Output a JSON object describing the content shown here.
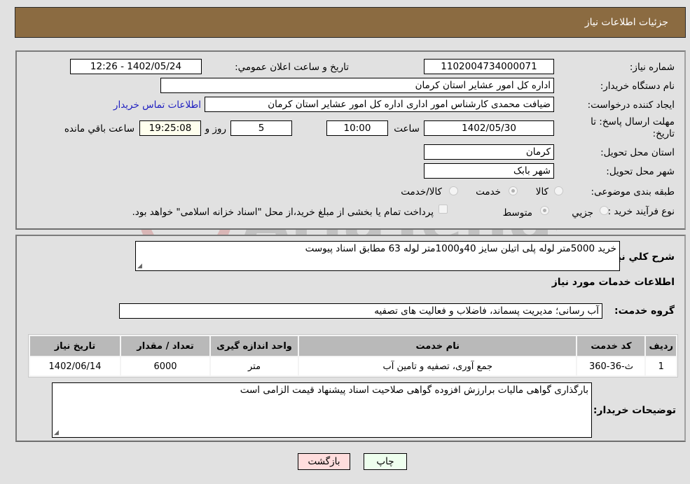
{
  "header": {
    "title": "جزئیات اطلاعات نیاز"
  },
  "form": {
    "need_number": {
      "label": "شماره نیاز:",
      "value": "1102004734000071"
    },
    "announce_datetime": {
      "label": "تاریخ و ساعت اعلان عمومي:",
      "value": "1402/05/24 - 12:26"
    },
    "buyer_org": {
      "label": "نام دستگاه خریدار:",
      "value": "اداره کل امور عشایر استان کرمان"
    },
    "requester": {
      "label": "ایجاد کننده درخواست:",
      "value": "ضیافت محمدی کارشناس امور اداری اداره کل امور عشایر استان کرمان"
    },
    "buyer_contact_link": "اطلاعات تماس خریدار",
    "deadline": {
      "label": "مهلت ارسال پاسخ: تا تاریخ:",
      "date": "1402/05/30",
      "time_label": "ساعت",
      "time": "10:00",
      "days": "5",
      "days_label": "روز و",
      "remaining": "19:25:08",
      "remaining_label": "ساعت باقي مانده"
    },
    "province": {
      "label": "استان محل تحویل:",
      "value": "کرمان"
    },
    "city": {
      "label": "شهر محل تحویل:",
      "value": "شهر بابک"
    },
    "category": {
      "label": "طبقه بندی موضوعی:",
      "options": [
        "کالا",
        "خدمت",
        "کالا/خدمت"
      ],
      "selected": "خدمت"
    },
    "purchase_type": {
      "label": "نوع فرآیند خرید :",
      "options": [
        "جزیي",
        "متوسط"
      ],
      "selected": "متوسط",
      "treasury_note": "پرداخت تمام یا بخشی از مبلغ خرید،از محل \"اسناد خزانه اسلامی\" خواهد بود."
    }
  },
  "details": {
    "description_label": "شرح کلي نیاز:",
    "description": "خرید 5000متر لوله پلی اتیلن سایز 40و1000متر لوله 63 مطابق اسناد پیوست",
    "services_heading": "اطلاعات خدمات مورد نیاز",
    "service_group_label": "گروه خدمت:",
    "service_group": "آب رسانی؛ مدیریت پسماند، فاضلاب و فعالیت های تصفیه",
    "table": {
      "headers": [
        "ردیف",
        "کد خدمت",
        "نام خدمت",
        "واحد اندازه گیری",
        "تعداد / مقدار",
        "تاریخ نیاز"
      ],
      "rows": [
        [
          "1",
          "ث-36-360",
          "جمع آوری، تصفیه و تامین آب",
          "متر",
          "6000",
          "1402/06/14"
        ]
      ]
    },
    "buyer_notes_label": "توضیحات خریدار:",
    "buyer_notes": "بارگذاری گواهی مالیات برارزش افزوده گواهی صلاحیت اسناد پیشنهاد قیمت الزامی است"
  },
  "buttons": {
    "print": "چاپ",
    "back": "بازگشت"
  },
  "colors": {
    "header_bg": "#8b6b41",
    "print_bg": "#eeffee",
    "back_bg": "#ffdddd",
    "link": "#2020c0"
  },
  "watermark": {
    "text": "AriaTender.net"
  }
}
